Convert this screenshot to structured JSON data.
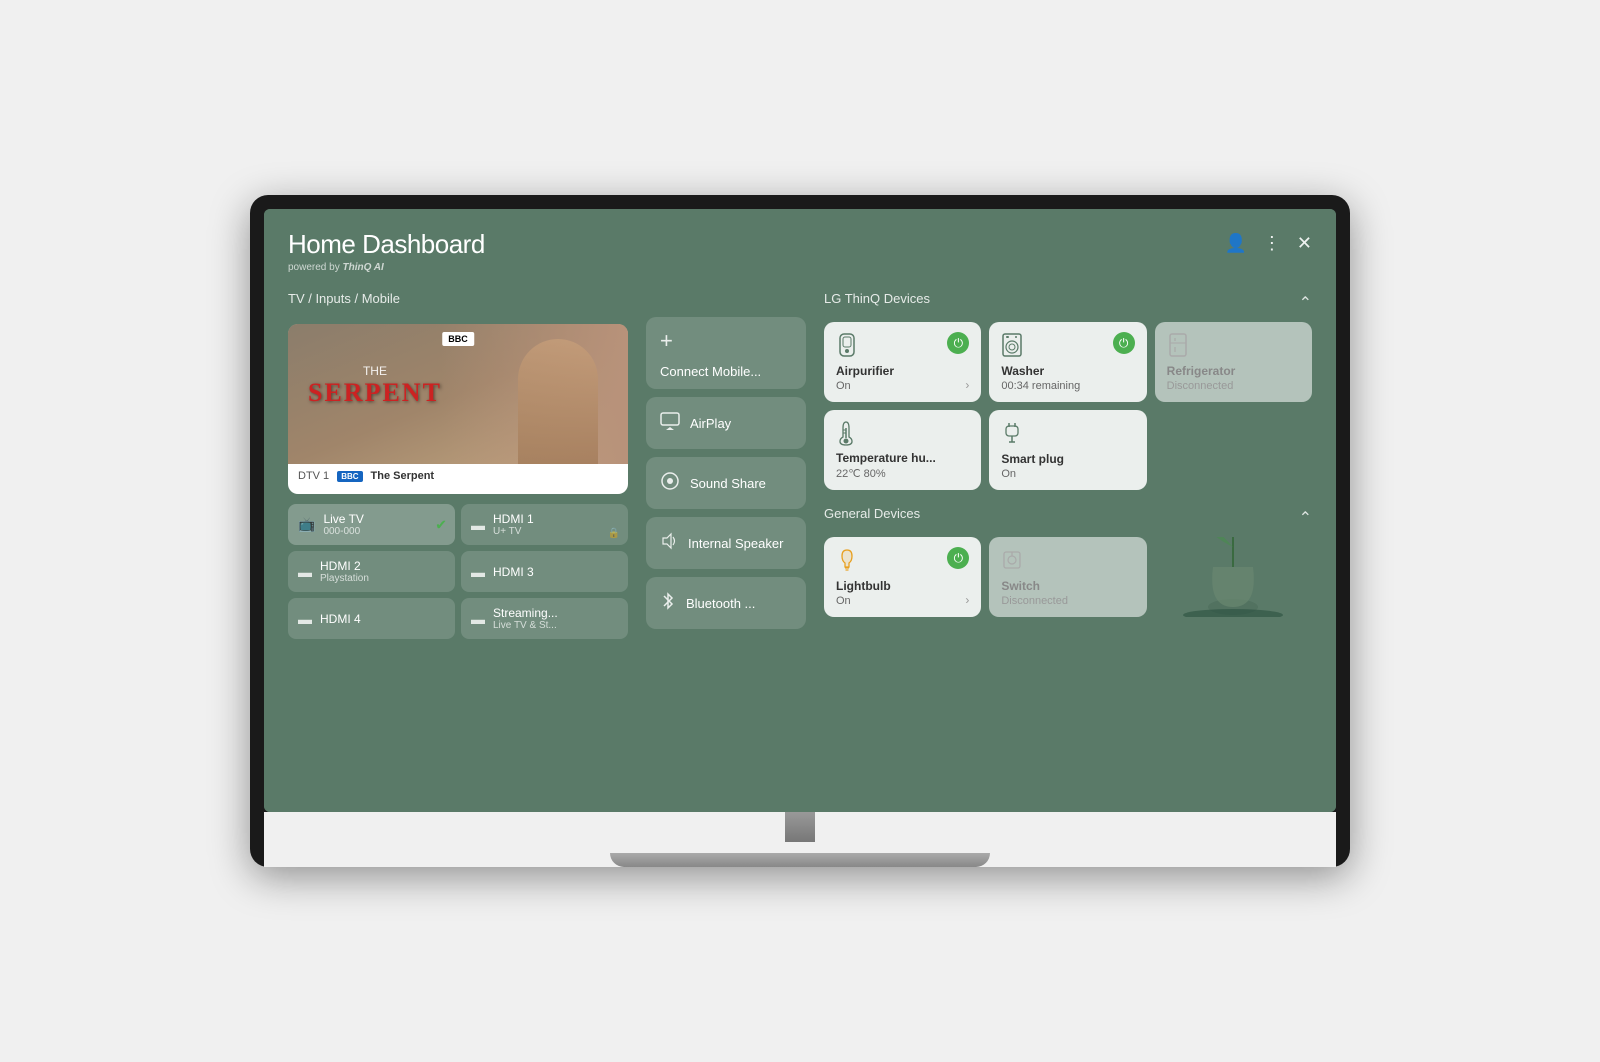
{
  "header": {
    "title": "Home Dashboard",
    "subtitle": "powered by",
    "thinq": "ThinQ AI",
    "icons": [
      "person",
      "more",
      "close"
    ]
  },
  "left_section": {
    "label": "TV / Inputs / Mobile",
    "tv_preview": {
      "channel": "DTV 1",
      "channel_badge": "BBC",
      "show_the": "THE",
      "show_name": "SERPENT",
      "program_label": "The Serpent"
    },
    "inputs": [
      {
        "name": "Live TV",
        "sub": "000-000",
        "active": true,
        "icon": "📺"
      },
      {
        "name": "HDMI 1",
        "sub": "U+ TV",
        "active": false,
        "icon": "⬛",
        "lock": true
      },
      {
        "name": "HDMI 2",
        "sub": "Playstation",
        "active": false,
        "icon": "⬛"
      },
      {
        "name": "HDMI 3",
        "sub": "",
        "active": false,
        "icon": "⬛"
      },
      {
        "name": "HDMI 4",
        "sub": "",
        "active": false,
        "icon": "⬛"
      },
      {
        "name": "Streaming...",
        "sub": "Live TV & St...",
        "active": false,
        "icon": "⬛"
      }
    ]
  },
  "middle_section": {
    "actions": [
      {
        "label": "Connect Mobile...",
        "icon": "+",
        "type": "connect"
      },
      {
        "label": "AirPlay",
        "icon": "📡",
        "type": "normal"
      },
      {
        "label": "Sound Share",
        "icon": "🔊",
        "type": "normal"
      },
      {
        "label": "Internal Speaker",
        "icon": "🔈",
        "type": "normal"
      },
      {
        "label": "Bluetooth ...",
        "icon": "🔵",
        "type": "normal"
      }
    ]
  },
  "thinq_devices": {
    "section_label": "LG ThinQ Devices",
    "devices": [
      {
        "name": "Airpurifier",
        "status": "On",
        "icon": "💧",
        "power": true,
        "disconnected": false,
        "has_arrow": true
      },
      {
        "name": "Washer",
        "status": "00:34 remaining",
        "icon": "🫧",
        "power": true,
        "disconnected": false,
        "has_arrow": false
      },
      {
        "name": "Refrigerator",
        "status": "Disconnected",
        "icon": "🧊",
        "power": false,
        "disconnected": true,
        "has_arrow": false
      },
      {
        "name": "Temperature hu...",
        "status": "22℃ 80%",
        "icon": "🌡",
        "power": false,
        "disconnected": false,
        "has_arrow": false
      },
      {
        "name": "Smart plug",
        "status": "On",
        "icon": "🔌",
        "power": false,
        "disconnected": false,
        "has_arrow": false
      }
    ]
  },
  "general_devices": {
    "section_label": "General Devices",
    "devices": [
      {
        "name": "Lightbulb",
        "status": "On",
        "icon": "💡",
        "power": true,
        "disconnected": false,
        "has_arrow": true
      },
      {
        "name": "Switch",
        "status": "Disconnected",
        "icon": "🔘",
        "power": false,
        "disconnected": true,
        "has_arrow": false
      }
    ]
  }
}
